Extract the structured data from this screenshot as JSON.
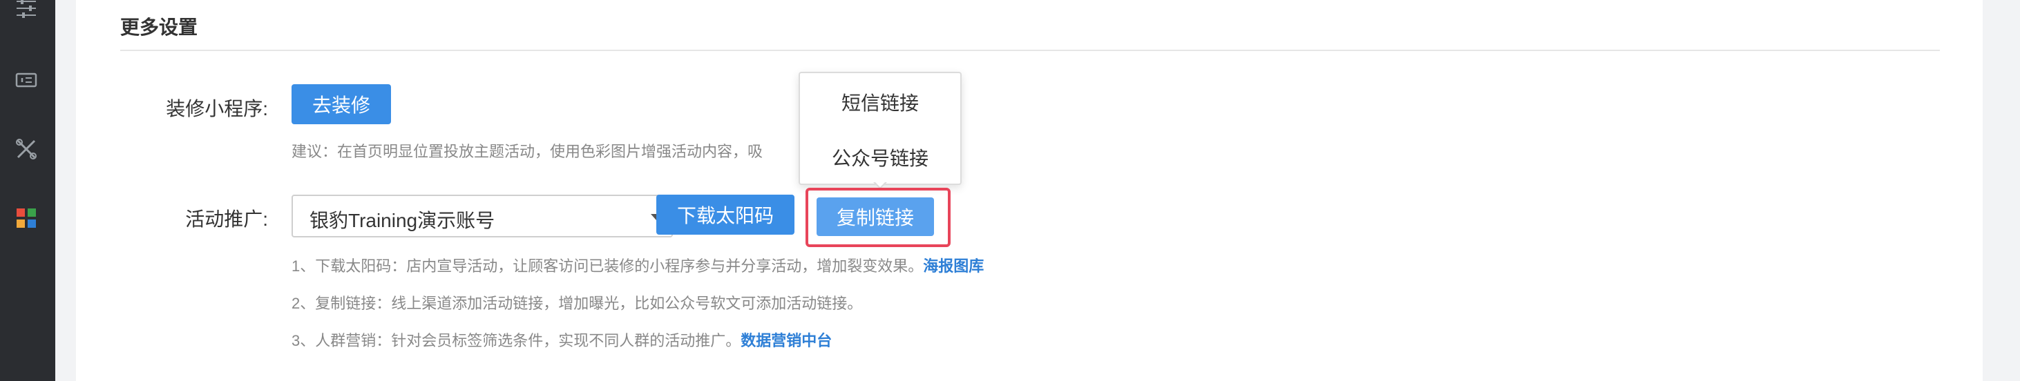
{
  "section": {
    "title": "更多设置"
  },
  "decorate": {
    "label": "装修小程序:",
    "button_label": "去装修",
    "suggestion": "建议：在首页明显位置投放主题活动，使用色彩图片增强活动内容，吸"
  },
  "promote": {
    "label": "活动推广:",
    "account_select_value": "银豹Training演示账号",
    "download_button": "下载太阳码",
    "copy_button": "复制链接",
    "hints": [
      {
        "text": "1、下载太阳码：店内宣导活动，让顾客访问已装修的小程序参与并分享活动，增加裂变效果。",
        "link": "海报图库"
      },
      {
        "text": "2、复制链接：线上渠道添加活动链接，增加曝光，比如公众号软文可添加活动链接。",
        "link": ""
      },
      {
        "text": "3、人群营销：针对会员标签筛选条件，实现不同人群的活动推广。",
        "link": "数据营销中台"
      }
    ]
  },
  "popup": {
    "items": [
      "短信链接",
      "公众号链接"
    ]
  },
  "sidebar": {
    "icons": [
      "sliders-icon",
      "ticket-icon",
      "tools-icon",
      "apps-grid-icon"
    ]
  },
  "colors": {
    "primary": "#3a8ee6",
    "highlight": "#e8455a",
    "link": "#2e7fd6",
    "sidebar_bg": "#2b2d31"
  }
}
